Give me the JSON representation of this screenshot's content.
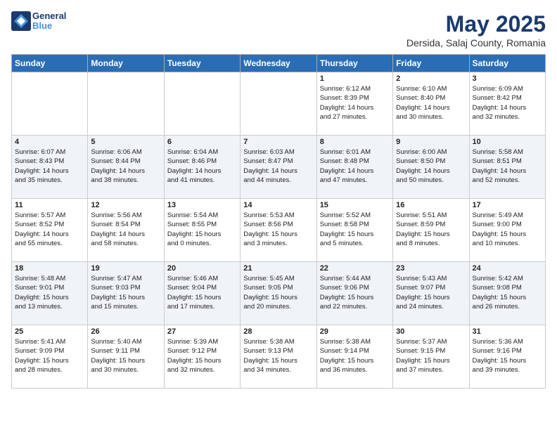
{
  "header": {
    "logo_line1": "General",
    "logo_line2": "Blue",
    "title": "May 2025",
    "subtitle": "Dersida, Salaj County, Romania"
  },
  "days_of_week": [
    "Sunday",
    "Monday",
    "Tuesday",
    "Wednesday",
    "Thursday",
    "Friday",
    "Saturday"
  ],
  "weeks": [
    [
      {
        "day": "",
        "info": ""
      },
      {
        "day": "",
        "info": ""
      },
      {
        "day": "",
        "info": ""
      },
      {
        "day": "",
        "info": ""
      },
      {
        "day": "1",
        "info": "Sunrise: 6:12 AM\nSunset: 8:39 PM\nDaylight: 14 hours\nand 27 minutes."
      },
      {
        "day": "2",
        "info": "Sunrise: 6:10 AM\nSunset: 8:40 PM\nDaylight: 14 hours\nand 30 minutes."
      },
      {
        "day": "3",
        "info": "Sunrise: 6:09 AM\nSunset: 8:42 PM\nDaylight: 14 hours\nand 32 minutes."
      }
    ],
    [
      {
        "day": "4",
        "info": "Sunrise: 6:07 AM\nSunset: 8:43 PM\nDaylight: 14 hours\nand 35 minutes."
      },
      {
        "day": "5",
        "info": "Sunrise: 6:06 AM\nSunset: 8:44 PM\nDaylight: 14 hours\nand 38 minutes."
      },
      {
        "day": "6",
        "info": "Sunrise: 6:04 AM\nSunset: 8:46 PM\nDaylight: 14 hours\nand 41 minutes."
      },
      {
        "day": "7",
        "info": "Sunrise: 6:03 AM\nSunset: 8:47 PM\nDaylight: 14 hours\nand 44 minutes."
      },
      {
        "day": "8",
        "info": "Sunrise: 6:01 AM\nSunset: 8:48 PM\nDaylight: 14 hours\nand 47 minutes."
      },
      {
        "day": "9",
        "info": "Sunrise: 6:00 AM\nSunset: 8:50 PM\nDaylight: 14 hours\nand 50 minutes."
      },
      {
        "day": "10",
        "info": "Sunrise: 5:58 AM\nSunset: 8:51 PM\nDaylight: 14 hours\nand 52 minutes."
      }
    ],
    [
      {
        "day": "11",
        "info": "Sunrise: 5:57 AM\nSunset: 8:52 PM\nDaylight: 14 hours\nand 55 minutes."
      },
      {
        "day": "12",
        "info": "Sunrise: 5:56 AM\nSunset: 8:54 PM\nDaylight: 14 hours\nand 58 minutes."
      },
      {
        "day": "13",
        "info": "Sunrise: 5:54 AM\nSunset: 8:55 PM\nDaylight: 15 hours\nand 0 minutes."
      },
      {
        "day": "14",
        "info": "Sunrise: 5:53 AM\nSunset: 8:56 PM\nDaylight: 15 hours\nand 3 minutes."
      },
      {
        "day": "15",
        "info": "Sunrise: 5:52 AM\nSunset: 8:58 PM\nDaylight: 15 hours\nand 5 minutes."
      },
      {
        "day": "16",
        "info": "Sunrise: 5:51 AM\nSunset: 8:59 PM\nDaylight: 15 hours\nand 8 minutes."
      },
      {
        "day": "17",
        "info": "Sunrise: 5:49 AM\nSunset: 9:00 PM\nDaylight: 15 hours\nand 10 minutes."
      }
    ],
    [
      {
        "day": "18",
        "info": "Sunrise: 5:48 AM\nSunset: 9:01 PM\nDaylight: 15 hours\nand 13 minutes."
      },
      {
        "day": "19",
        "info": "Sunrise: 5:47 AM\nSunset: 9:03 PM\nDaylight: 15 hours\nand 15 minutes."
      },
      {
        "day": "20",
        "info": "Sunrise: 5:46 AM\nSunset: 9:04 PM\nDaylight: 15 hours\nand 17 minutes."
      },
      {
        "day": "21",
        "info": "Sunrise: 5:45 AM\nSunset: 9:05 PM\nDaylight: 15 hours\nand 20 minutes."
      },
      {
        "day": "22",
        "info": "Sunrise: 5:44 AM\nSunset: 9:06 PM\nDaylight: 15 hours\nand 22 minutes."
      },
      {
        "day": "23",
        "info": "Sunrise: 5:43 AM\nSunset: 9:07 PM\nDaylight: 15 hours\nand 24 minutes."
      },
      {
        "day": "24",
        "info": "Sunrise: 5:42 AM\nSunset: 9:08 PM\nDaylight: 15 hours\nand 26 minutes."
      }
    ],
    [
      {
        "day": "25",
        "info": "Sunrise: 5:41 AM\nSunset: 9:09 PM\nDaylight: 15 hours\nand 28 minutes."
      },
      {
        "day": "26",
        "info": "Sunrise: 5:40 AM\nSunset: 9:11 PM\nDaylight: 15 hours\nand 30 minutes."
      },
      {
        "day": "27",
        "info": "Sunrise: 5:39 AM\nSunset: 9:12 PM\nDaylight: 15 hours\nand 32 minutes."
      },
      {
        "day": "28",
        "info": "Sunrise: 5:38 AM\nSunset: 9:13 PM\nDaylight: 15 hours\nand 34 minutes."
      },
      {
        "day": "29",
        "info": "Sunrise: 5:38 AM\nSunset: 9:14 PM\nDaylight: 15 hours\nand 36 minutes."
      },
      {
        "day": "30",
        "info": "Sunrise: 5:37 AM\nSunset: 9:15 PM\nDaylight: 15 hours\nand 37 minutes."
      },
      {
        "day": "31",
        "info": "Sunrise: 5:36 AM\nSunset: 9:16 PM\nDaylight: 15 hours\nand 39 minutes."
      }
    ]
  ]
}
